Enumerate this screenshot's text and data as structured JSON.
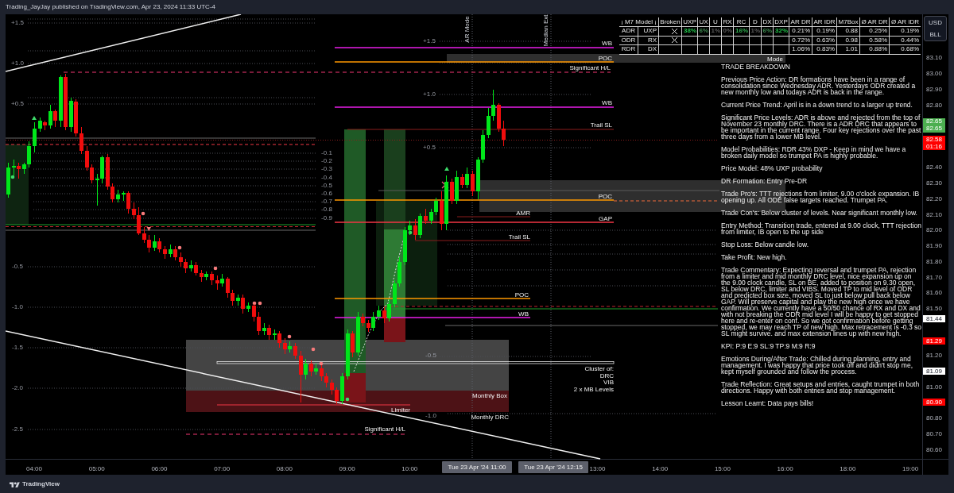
{
  "header": {
    "title": "Trading_JayJay published on TradingView.com, Apr 23, 2024 11:33 UTC-4"
  },
  "model_table": {
    "columns": [
      "¡ M7 Model ¡",
      "Broken",
      "UXP",
      "UX",
      "U",
      "RX",
      "RC",
      "D",
      "DX",
      "DXP",
      "AR DR",
      "AR IDR",
      "M7Box",
      "Ø AR DR",
      "Ø AR IDR"
    ],
    "rows": [
      {
        "range": "ADR",
        "model": "UXP",
        "broken": true,
        "probabilities": [
          {
            "text": "38%",
            "color": "#21c44a"
          },
          {
            "text": "6%",
            "color": "#3d8a4f"
          },
          {
            "text": "1%",
            "color": "#5a5a5a"
          },
          {
            "text": "0%",
            "color": "#5a5a5a"
          },
          {
            "text": "16%",
            "color": "#2fb04f"
          },
          {
            "text": "1%",
            "color": "#5a5a5a"
          },
          {
            "text": "6%",
            "color": "#3d8a4f"
          },
          {
            "text": "32%",
            "color": "#21c44a"
          }
        ],
        "stats": [
          "0.21%",
          "0.19%",
          "0.88",
          "0.25%",
          "0.19%"
        ]
      },
      {
        "range": "ODR",
        "model": "RX",
        "broken": true,
        "stats": [
          "0.72%",
          "0.63%",
          "0.98",
          "0.58%",
          "0.44%"
        ]
      },
      {
        "range": "RDR",
        "model": "DX",
        "broken": false,
        "stats": [
          "1.06%",
          "0.83%",
          "1.01",
          "0.88%",
          "0.68%"
        ]
      }
    ]
  },
  "unit_button": {
    "lines": [
      "USD",
      "BLL"
    ]
  },
  "price_axis": {
    "badges": [
      {
        "text": "82.65",
        "color": "#4caf50"
      },
      {
        "text": "82.65",
        "color": "#4caf50"
      },
      {
        "text": "82.58",
        "color": "#ff0000"
      },
      {
        "text": "01:16",
        "color": "#ff0000"
      },
      {
        "text": "81.44",
        "color": "#ffffff"
      },
      {
        "text": "81.29",
        "color": "#ff0000"
      },
      {
        "text": "81.09",
        "color": "#ffffff"
      },
      {
        "text": "80.90",
        "color": "#ff0000"
      }
    ]
  },
  "time_axis": {
    "badges": [
      "Tue 23 Apr '24 11:00",
      "Tue 23 Apr '24 12:15"
    ]
  },
  "chart": {
    "chart_data": {
      "type": "candlestick",
      "categories": [
        null,
        null,
        null,
        null,
        null,
        "04:00",
        null,
        null,
        null,
        null,
        null,
        null,
        null,
        null,
        null,
        null,
        null,
        "05:00",
        null,
        null,
        null,
        null,
        null,
        null,
        null,
        null,
        null,
        null,
        null,
        "06:00",
        null,
        null,
        null,
        null,
        null,
        null,
        null,
        null,
        null,
        null,
        null,
        "07:00",
        null,
        null,
        null,
        null,
        null,
        null,
        null,
        null,
        null,
        null,
        null,
        "08:00",
        null,
        null,
        null,
        null,
        null,
        null,
        null,
        null,
        null,
        null,
        null,
        "09:00",
        null,
        null,
        null,
        null,
        null,
        null,
        null,
        null,
        null,
        null,
        null,
        "10:00",
        null,
        null,
        null,
        null,
        null,
        null,
        null,
        null,
        null,
        null,
        null,
        null,
        null,
        null,
        null,
        null,
        null,
        null,
        null,
        null,
        null,
        null,
        null,
        null,
        null,
        null,
        null,
        null,
        null,
        null,
        null,
        null,
        null,
        null,
        null,
        "13:00",
        null,
        null,
        null,
        null,
        null,
        null,
        null,
        null,
        null,
        null,
        null,
        "14:00",
        null,
        null,
        null,
        null,
        null,
        null,
        null,
        null,
        null,
        null,
        null,
        "15:00",
        null,
        null,
        null,
        null,
        null,
        null,
        null,
        null,
        null,
        null,
        null,
        "16:00",
        null,
        null,
        null,
        null,
        null,
        null,
        null,
        null,
        null,
        null,
        null,
        "18:00",
        null,
        null,
        null,
        null,
        null,
        null,
        null,
        null,
        null,
        null,
        null,
        "19:00"
      ],
      "ohlc": [
        [
          82.23,
          82.43,
          82.21,
          82.4
        ],
        [
          82.4,
          82.45,
          82.35,
          82.41
        ],
        [
          82.41,
          82.43,
          82.33,
          82.39
        ],
        [
          82.39,
          82.43,
          82.36,
          82.42
        ],
        [
          82.42,
          82.57,
          82.4,
          82.54
        ],
        [
          82.54,
          82.69,
          82.5,
          82.65
        ],
        [
          82.65,
          82.72,
          82.63,
          82.7
        ],
        [
          82.69,
          82.7,
          82.64,
          82.67
        ],
        [
          82.67,
          82.8,
          82.65,
          82.76
        ],
        [
          82.76,
          82.77,
          82.66,
          82.7
        ],
        [
          82.7,
          82.99,
          82.66,
          82.98
        ],
        [
          82.98,
          83.0,
          82.64,
          82.66
        ],
        [
          82.66,
          82.85,
          82.63,
          82.83
        ],
        [
          82.82,
          82.84,
          82.6,
          82.62
        ],
        [
          82.62,
          82.66,
          82.49,
          82.51
        ],
        [
          82.51,
          82.54,
          82.38,
          82.4
        ],
        [
          82.4,
          82.42,
          82.3,
          82.32
        ],
        [
          82.32,
          82.36,
          82.16,
          82.33
        ],
        [
          82.33,
          82.48,
          82.3,
          82.47
        ],
        [
          82.47,
          82.49,
          82.26,
          82.28
        ],
        [
          82.28,
          82.3,
          82.18,
          82.2
        ],
        [
          82.2,
          82.26,
          82.18,
          82.23
        ],
        [
          82.23,
          82.25,
          82.19,
          82.24
        ],
        [
          82.24,
          82.25,
          82.11,
          82.14
        ],
        [
          82.14,
          82.18,
          82.07,
          82.1
        ],
        [
          82.1,
          82.15,
          81.97,
          81.98
        ],
        [
          81.98,
          82.02,
          81.92,
          81.94
        ],
        [
          81.94,
          81.97,
          81.86,
          81.89
        ],
        [
          81.89,
          81.97,
          81.87,
          81.93
        ],
        [
          81.93,
          81.95,
          81.86,
          81.88
        ],
        [
          81.88,
          81.9,
          81.82,
          81.85
        ],
        [
          81.85,
          81.91,
          81.83,
          81.88
        ],
        [
          81.88,
          81.9,
          81.81,
          81.83
        ],
        [
          81.83,
          81.86,
          81.77,
          81.8
        ],
        [
          81.8,
          81.82,
          81.73,
          81.76
        ],
        [
          81.76,
          81.81,
          81.74,
          81.78
        ],
        [
          81.78,
          81.8,
          81.71,
          81.73
        ],
        [
          81.73,
          81.75,
          81.67,
          81.7
        ],
        [
          81.7,
          81.74,
          81.68,
          81.72
        ],
        [
          81.72,
          81.74,
          81.65,
          81.68
        ],
        [
          81.68,
          81.71,
          81.62,
          81.66
        ],
        [
          81.66,
          81.72,
          81.64,
          81.69
        ],
        [
          81.69,
          81.7,
          81.57,
          81.6
        ],
        [
          81.6,
          81.62,
          81.52,
          81.55
        ],
        [
          81.55,
          81.59,
          81.52,
          81.57
        ],
        [
          81.57,
          81.59,
          81.47,
          81.5
        ],
        [
          81.5,
          81.54,
          81.48,
          81.52
        ],
        [
          81.52,
          81.53,
          81.42,
          81.45
        ],
        [
          81.45,
          81.48,
          81.33,
          81.36
        ],
        [
          81.36,
          81.41,
          81.33,
          81.38
        ],
        [
          81.38,
          81.4,
          81.3,
          81.33
        ],
        [
          81.33,
          81.37,
          81.3,
          81.34
        ],
        [
          81.34,
          81.36,
          81.25,
          81.28
        ],
        [
          81.28,
          81.31,
          81.21,
          81.24
        ],
        [
          81.24,
          81.29,
          81.22,
          81.26
        ],
        [
          81.26,
          81.28,
          81.18,
          81.2
        ],
        [
          81.2,
          81.23,
          80.9,
          81.08
        ],
        [
          81.08,
          81.18,
          81.05,
          81.15
        ],
        [
          81.15,
          81.17,
          81.07,
          81.1
        ],
        [
          81.1,
          81.15,
          81.08,
          81.12
        ],
        [
          81.12,
          81.14,
          81.04,
          81.07
        ],
        [
          81.07,
          81.09,
          81.0,
          81.03
        ],
        [
          81.03,
          81.05,
          80.95,
          80.98
        ],
        [
          80.98,
          81.0,
          80.89,
          80.91
        ],
        [
          80.91,
          81.09,
          80.89,
          81.07
        ],
        [
          81.07,
          81.37,
          81.05,
          81.34
        ],
        [
          81.34,
          81.36,
          81.19,
          81.22
        ],
        [
          81.22,
          81.48,
          81.2,
          81.45
        ],
        [
          81.45,
          81.47,
          81.39,
          81.41
        ],
        [
          81.41,
          81.43,
          81.35,
          81.38
        ],
        [
          81.38,
          81.48,
          81.36,
          81.45
        ],
        [
          81.45,
          81.52,
          81.43,
          81.49
        ],
        [
          81.49,
          81.51,
          81.41,
          81.44
        ],
        [
          81.44,
          81.56,
          81.42,
          81.53
        ],
        [
          81.53,
          81.68,
          81.51,
          81.66
        ],
        [
          81.66,
          81.83,
          81.64,
          81.8
        ],
        [
          81.8,
          82.02,
          81.78,
          82.0
        ],
        [
          82.0,
          82.06,
          81.97,
          82.03
        ],
        [
          82.03,
          82.07,
          81.94,
          81.97
        ],
        [
          81.97,
          82.11,
          81.95,
          82.09
        ],
        [
          82.09,
          82.14,
          82.04,
          82.06
        ],
        [
          82.06,
          82.14,
          82.04,
          82.12
        ],
        [
          82.12,
          82.21,
          82.1,
          82.19
        ],
        [
          82.19,
          82.25,
          82.0,
          82.04
        ],
        [
          82.04,
          82.35,
          82.0,
          82.31
        ],
        [
          82.31,
          82.33,
          82.17,
          82.19
        ],
        [
          82.19,
          82.38,
          82.17,
          82.34
        ],
        [
          82.34,
          82.36,
          82.27,
          82.29
        ],
        [
          82.29,
          82.4,
          82.27,
          82.36
        ],
        [
          82.36,
          82.38,
          82.22,
          82.25
        ],
        [
          82.25,
          82.47,
          82.2,
          82.45
        ],
        [
          82.45,
          82.64,
          82.43,
          82.61
        ],
        [
          82.61,
          82.78,
          82.59,
          82.73
        ],
        [
          82.73,
          82.9,
          82.7,
          82.8
        ],
        [
          82.8,
          82.81,
          82.63,
          82.65
        ],
        [
          82.65,
          82.7,
          82.54,
          82.58
        ],
        null,
        null,
        null,
        null,
        null,
        null,
        null,
        null,
        null,
        null,
        null,
        null,
        null,
        null,
        null,
        null,
        null,
        null,
        null,
        null,
        null,
        null,
        null,
        null,
        null,
        null,
        null,
        null,
        null,
        null,
        null,
        null,
        null,
        null,
        null,
        null,
        null,
        null,
        null,
        null,
        null,
        null,
        null,
        null,
        null,
        null,
        null,
        null,
        null,
        null,
        null,
        null,
        null,
        null,
        null,
        null,
        null,
        null,
        null,
        null,
        null,
        null,
        null,
        null,
        null,
        null,
        null,
        null,
        null,
        null,
        null,
        null,
        null,
        null,
        null,
        null,
        null,
        null
      ],
      "yticks": [
        {
          "value": 83.1,
          "label": "83.10"
        },
        {
          "value": 83.0,
          "label": "83.00"
        },
        {
          "value": 82.9,
          "label": "82.90"
        },
        {
          "value": 82.8,
          "label": "82.80"
        },
        {
          "value": 82.4,
          "label": "82.40"
        },
        {
          "value": 82.3,
          "label": "82.30"
        },
        {
          "value": 82.2,
          "label": "82.20"
        },
        {
          "value": 82.1,
          "label": "82.10"
        },
        {
          "value": 82.0,
          "label": "82.00"
        },
        {
          "value": 81.9,
          "label": "81.90"
        },
        {
          "value": 81.8,
          "label": "81.80"
        },
        {
          "value": 81.7,
          "label": "81.70"
        },
        {
          "value": 81.6,
          "label": "81.60"
        },
        {
          "value": 81.5,
          "label": "81.50"
        },
        {
          "value": 81.2,
          "label": "81.20"
        },
        {
          "value": 81.0,
          "label": "81.00"
        },
        {
          "value": 80.8,
          "label": "80.80"
        },
        {
          "value": 80.7,
          "label": "80.70"
        },
        {
          "value": 80.6,
          "label": "80.60"
        }
      ],
      "ylim": [
        80.44,
        83.38
      ]
    },
    "fib_labels": [
      "+1.5",
      "+1.0",
      "+0.5",
      "-0.1",
      "-0.2",
      "-0.3",
      "-0.4",
      "-0.5",
      "-0.6",
      "-0.7",
      "-0.8",
      "-0.9",
      "-0.5",
      "-1.0",
      "-1.5",
      "-2.0",
      "-2.5",
      "+1.5",
      "+1.0",
      "+0.5",
      "-0.5",
      "-1.0"
    ],
    "marker_lines": [
      "AR Mode",
      "Median Ext"
    ],
    "level_labels": [
      "WB",
      "POC",
      "Mode",
      "Significant H/L",
      "WB",
      "Trail SL",
      "POC",
      "AMR",
      "GAP",
      "Trail SL",
      "POC",
      "WB",
      "Monthly Box",
      "Limiter",
      "Monthly DRC",
      "Significant H/L"
    ],
    "cluster_note": [
      "Cluster of:",
      "DRC",
      "VIB",
      "2 x MB Levels"
    ]
  },
  "trade_note": {
    "title": "TRADE BREAKDOWN",
    "paragraphs": [
      "Previous Price Action: DR formations have been in a range of consolidation since Wednesday ADR. Yesterdays ODR created a new monthly low and todays ADR is back in the range.",
      "Current Price Trend: April is in a down trend to a larger up trend.",
      "Significant Price Levels: ADR is above and rejected from the top of November 23 monthly DRC. There is a ADR DRC that appears to be important in the current range. Four key rejections over the past three days from a lower MB level.",
      "Model Probabilities: RDR 43% DXP - Keep in mind we have a broken daily model so trumpet PA is highly probable.",
      "Price Model: 48% UXP probability",
      "DR Formation: Entry Pre-DR",
      "Trade Pro's: TTT rejections from limiter, 9.00 o'clock expansion. IB opening up. All ODE false targets reached. Trumpet PA.",
      "Trade Con's: Below cluster of levels. Near significant monthly low.",
      "Entry Method: Transition trade, entered at 9.00 clock, TTT rejection from limiter, IB open to the up side",
      "Stop Loss: Below candle low.",
      "Take Profit: New high.",
      "Trade Commentary: Expecting reversal and trumpet PA, rejection from a limiter and mid monthly DRC level, nice expansion up on the 9.00 clock candle, SL on BE, added to position on 9.30 open, SL below DRC, limiter and VIBS. Moved TP to mid level of ODR and predicted box size, moved SL to just below pull back below GAP. Will preserve capital and play the new high once we have confirmation. We currently have a 50/50 chance of RX and DX and with not breaking the ODR mid level I will be happy to get stopped here and re-enter on conf. So we got confirmation before getting stopped, we may reach TP of new high. Max retracement is -0.3 so SL might survive. and max extension lines up with new high.",
      "KPI: P:9 E:9 SL:9 TP:9 M:9 R:9",
      "Emotions During/After Trade: Chilled during planning, entry and management. I was happy that price took off and didn't stop me, kept myself grounded and follow the process.",
      "Trade Reflection: Great setups and entries, caught trumpet in both directions. Happy with both entries and stop management.",
      "Lesson Learnt: Data pays bills!"
    ]
  },
  "footer": {
    "brand": "TradingView"
  }
}
